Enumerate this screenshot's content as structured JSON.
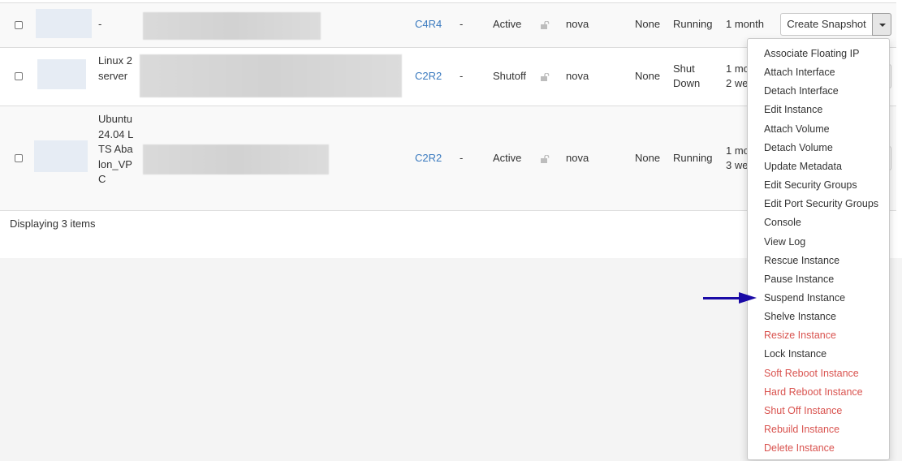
{
  "instances": [
    {
      "name": "-",
      "flavor": "C4R4",
      "key_pair": "-",
      "status": "Active",
      "availability_zone": "nova",
      "task": "None",
      "power_state": "Running",
      "age_line1": "1 month",
      "age_line2": ""
    },
    {
      "name": "Linux 2 server",
      "flavor": "C2R2",
      "key_pair": "-",
      "status": "Shutoff",
      "availability_zone": "nova",
      "task": "None",
      "power_state_line1": "Shut",
      "power_state_line2": "Down",
      "age_line1": "1 mo",
      "age_line2": "2 we"
    },
    {
      "name": "Ubuntu 24.04 LTS Abalon_VPC",
      "flavor": "C2R2",
      "key_pair": "-",
      "status": "Active",
      "availability_zone": "nova",
      "task": "None",
      "power_state": "Running",
      "age_line1": "1 mo",
      "age_line2": "3 we"
    }
  ],
  "row_action": {
    "primary_label": "Create Snapshot",
    "toggle_icon": "caret-down-icon"
  },
  "dropdown_items": [
    {
      "label": "Associate Floating IP",
      "danger": false
    },
    {
      "label": "Attach Interface",
      "danger": false
    },
    {
      "label": "Detach Interface",
      "danger": false
    },
    {
      "label": "Edit Instance",
      "danger": false
    },
    {
      "label": "Attach Volume",
      "danger": false
    },
    {
      "label": "Detach Volume",
      "danger": false
    },
    {
      "label": "Update Metadata",
      "danger": false
    },
    {
      "label": "Edit Security Groups",
      "danger": false
    },
    {
      "label": "Edit Port Security Groups",
      "danger": false
    },
    {
      "label": "Console",
      "danger": false
    },
    {
      "label": "View Log",
      "danger": false
    },
    {
      "label": "Rescue Instance",
      "danger": false
    },
    {
      "label": "Pause Instance",
      "danger": false
    },
    {
      "label": "Suspend Instance",
      "danger": false
    },
    {
      "label": "Shelve Instance",
      "danger": false
    },
    {
      "label": "Resize Instance",
      "danger": true
    },
    {
      "label": "Lock Instance",
      "danger": false
    },
    {
      "label": "Soft Reboot Instance",
      "danger": true
    },
    {
      "label": "Hard Reboot Instance",
      "danger": true
    },
    {
      "label": "Shut Off Instance",
      "danger": true
    },
    {
      "label": "Rebuild Instance",
      "danger": true
    },
    {
      "label": "Delete Instance",
      "danger": true
    }
  ],
  "footer": {
    "count_text": "Displaying 3 items"
  },
  "colors": {
    "link": "#3a7abf",
    "danger": "#d9534f",
    "annotation_arrow": "#1a0aa6"
  },
  "annotation": {
    "icon": "arrow-right-icon",
    "points_to": "Suspend Instance"
  }
}
